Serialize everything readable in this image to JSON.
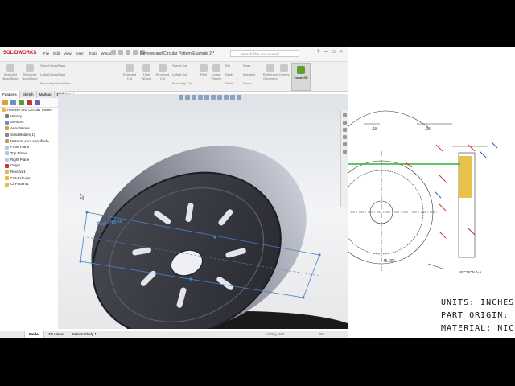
{
  "app": {
    "logo": "SOLIDWORKS",
    "menu": [
      "File",
      "Edit",
      "View",
      "Insert",
      "Tools",
      "Window"
    ],
    "document_title": "Revolve and Circular Pattern Example 2 *",
    "search_placeholder": "Search files and models",
    "window_controls": [
      "?",
      "–",
      "□",
      "×"
    ]
  },
  "ribbon": {
    "buttons": [
      {
        "label": "Extruded Boss/Base"
      },
      {
        "label": "Revolved Boss/Base"
      },
      {
        "label": "Swept Boss/Base"
      },
      {
        "label": "Lofted Boss/Base"
      },
      {
        "label": "Boundary Boss/Base"
      },
      {
        "label": "Extruded Cut"
      },
      {
        "label": "Hole Wizard"
      },
      {
        "label": "Revolved Cut"
      },
      {
        "label": "Swept Cut"
      },
      {
        "label": "Lofted Cut"
      },
      {
        "label": "Boundary Cut"
      },
      {
        "label": "Fillet"
      },
      {
        "label": "Linear Pattern"
      },
      {
        "label": "Rib"
      },
      {
        "label": "Draft"
      },
      {
        "label": "Shell"
      },
      {
        "label": "Wrap"
      },
      {
        "label": "Intersect"
      },
      {
        "label": "Mirror"
      },
      {
        "label": "Reference Geometry"
      },
      {
        "label": "Curves"
      }
    ],
    "instant3d": "Instant3D"
  },
  "tabs": [
    "Features",
    "Sketch",
    "Markup",
    "Evaluate"
  ],
  "feature_tree": [
    {
      "label": "Revolve and Circular Patter",
      "icon": "part-icon",
      "color": "#e8b84a"
    },
    {
      "label": "History",
      "icon": "history-icon",
      "color": "#7a7a7a"
    },
    {
      "label": "Sensors",
      "icon": "sensor-icon",
      "color": "#6b8fc7"
    },
    {
      "label": "Annotations",
      "icon": "annotation-icon",
      "color": "#d9a33b"
    },
    {
      "label": "Solid Bodies(1)",
      "icon": "solid-bodies-icon",
      "color": "#8a8a8a"
    },
    {
      "label": "Material <not specified>",
      "icon": "material-icon",
      "color": "#c59a5f"
    },
    {
      "label": "Front Plane",
      "icon": "plane-icon",
      "color": "#b7c7dd"
    },
    {
      "label": "Top Plane",
      "icon": "plane-icon",
      "color": "#b7c7dd"
    },
    {
      "label": "Right Plane",
      "icon": "plane-icon",
      "color": "#b7c7dd"
    },
    {
      "label": "Origin",
      "icon": "origin-icon",
      "color": "#c0392b"
    },
    {
      "label": "Revolve1",
      "icon": "revolve-icon",
      "color": "#e8b84a"
    },
    {
      "label": "Cut-Extrude1",
      "icon": "cut-extrude-icon",
      "color": "#e8b84a"
    },
    {
      "label": "CirPattern1",
      "icon": "circular-pattern-icon",
      "color": "#e8b84a"
    }
  ],
  "viewport": {
    "plane_label": "Top Plane"
  },
  "bottom_tabs": [
    "Model",
    "3D Views",
    "Motion Study 1"
  ],
  "status": {
    "left": "Editing Part",
    "right": "IPS"
  },
  "drawing": {
    "dimensions": [
      ".15",
      ".25",
      "45.00°"
    ],
    "section_label": "SECTION A-A",
    "units_text": "UNITS: INCHES",
    "origin_text": "PART ORIGIN: Z-A",
    "material_text": "MATERIAL: NICKEL",
    "accent_colors": {
      "highlight": "#e6c24a",
      "green_line": "#2bb23a",
      "red_marks": "#d03030",
      "blue_marks": "#2b57c7"
    }
  }
}
